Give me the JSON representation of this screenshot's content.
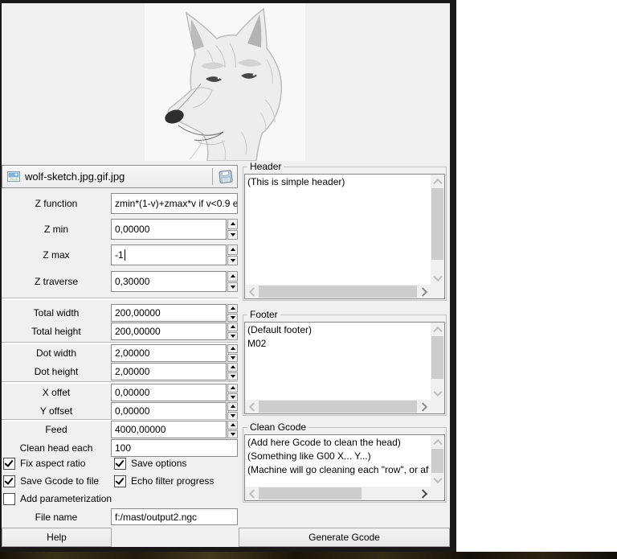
{
  "file_row": {
    "filename": "wolf-sketch.jpg.gif.jpg",
    "thumbnail_icon": "image-thumbnail-icon",
    "save_icon": "save-icon"
  },
  "form": {
    "rows": [
      {
        "label": "Z function",
        "value": "zmin*(1-v)+zmax*v if v<0.9 e",
        "spinner": false
      },
      {
        "label": "Z min",
        "value": "0,00000",
        "spinner": true
      },
      {
        "label": "Z max",
        "value": "-1",
        "spinner": true,
        "focused": true
      },
      {
        "label": "Z traverse",
        "value": "0,30000",
        "spinner": true
      },
      {
        "label": "Total width",
        "value": "200,00000",
        "spinner": true
      },
      {
        "label": "Total height",
        "value": "200,00000",
        "spinner": true
      },
      {
        "label": "Dot width",
        "value": "2,00000",
        "spinner": true
      },
      {
        "label": "Dot height",
        "value": "2,00000",
        "spinner": true
      },
      {
        "label": "X offet",
        "value": "0,00000",
        "spinner": true
      },
      {
        "label": "Y offset",
        "value": "0,00000",
        "spinner": true
      },
      {
        "label": "Feed",
        "value": "4000,00000",
        "spinner": true
      },
      {
        "label": "Clean head each",
        "value": "100",
        "spinner": false
      }
    ]
  },
  "checkboxes": [
    {
      "label": "Fix aspect ratio",
      "checked": true
    },
    {
      "label": "Save options",
      "checked": true
    },
    {
      "label": "Save Gcode to file",
      "checked": true
    },
    {
      "label": "Echo filter progress",
      "checked": true
    },
    {
      "label": "Add parameterization",
      "checked": false
    }
  ],
  "file_name": {
    "label": "File name",
    "value": "f:/mast/output2.ngc"
  },
  "buttons": {
    "help": "Help",
    "generate": "Generate Gcode"
  },
  "groups": [
    {
      "title": "Header",
      "text": "(This is simple header)"
    },
    {
      "title": "Footer",
      "text": "(Default footer)\nM02"
    },
    {
      "title": "Clean Gcode",
      "text": "(Add here Gcode to clean the head)\n(Something like G00 X... Y...)\n(Machine will go cleaning each \"row\", or aft"
    }
  ],
  "colors": {
    "window_bg": "#f0f0f0",
    "window_frame": "#181818",
    "save_icon_blue": "#b9cfe4"
  }
}
